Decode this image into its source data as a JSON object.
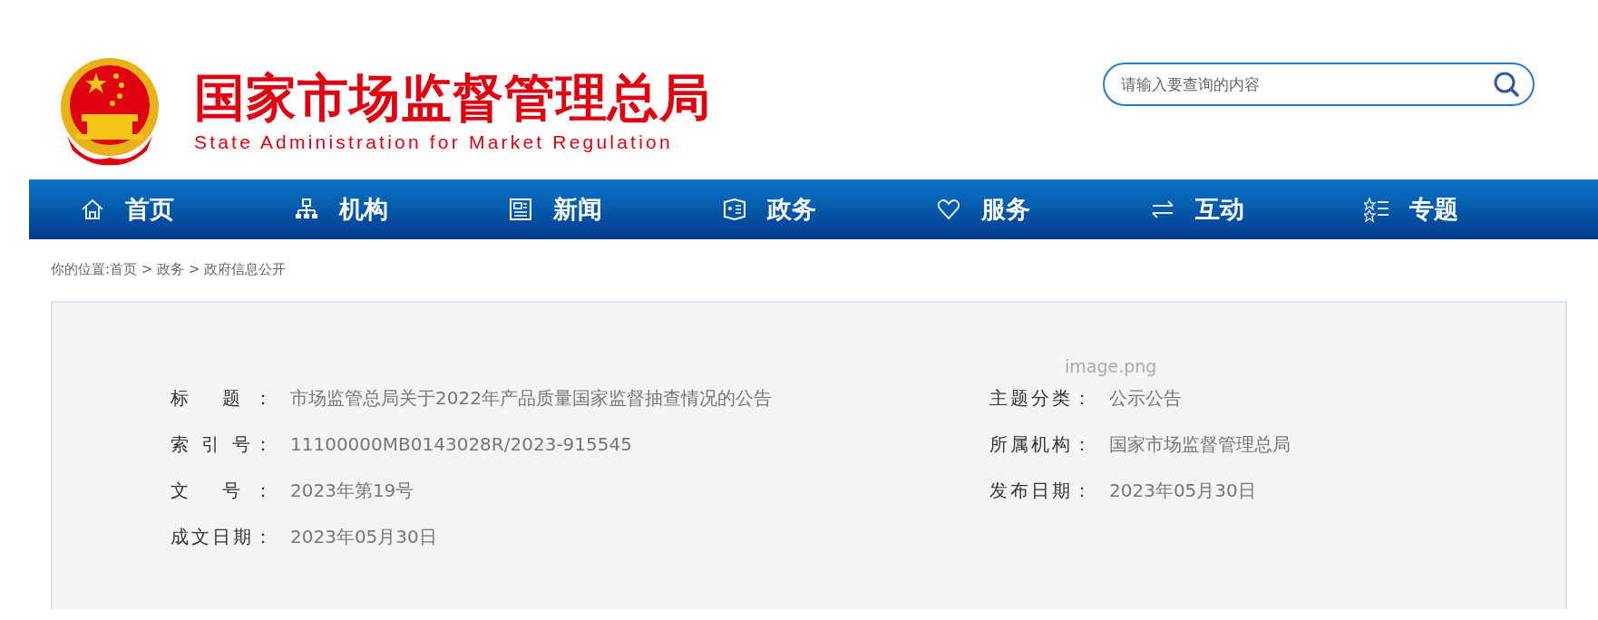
{
  "header": {
    "title": "国家市场监督管理总局",
    "subtitle": "State Administration for Market Regulation",
    "search": {
      "placeholder": "请输入要查询的内容"
    }
  },
  "nav": [
    {
      "label": "首页"
    },
    {
      "label": "机构"
    },
    {
      "label": "新闻"
    },
    {
      "label": "政务"
    },
    {
      "label": "服务"
    },
    {
      "label": "互动"
    },
    {
      "label": "专题"
    }
  ],
  "breadcrumb": "你的位置:首页 > 政务 > 政府信息公开",
  "details": {
    "image_alt": "image.png",
    "left_fields": [
      {
        "label": "标 题：",
        "value": "市场监管总局关于2022年产品质量国家监督抽查情况的公告"
      },
      {
        "label": "索 引 号：",
        "value": "11100000MB0143028R/2023-915545"
      },
      {
        "label": "文 号：",
        "value": "2023年第19号"
      },
      {
        "label": "成文日期：",
        "value": "2023年05月30日"
      }
    ],
    "right_fields": [
      {
        "label": "主题分类：",
        "value": "公示公告"
      },
      {
        "label": "所属机构：",
        "value": "国家市场监督管理总局"
      },
      {
        "label": "发布日期：",
        "value": "2023年05月30日"
      }
    ]
  }
}
